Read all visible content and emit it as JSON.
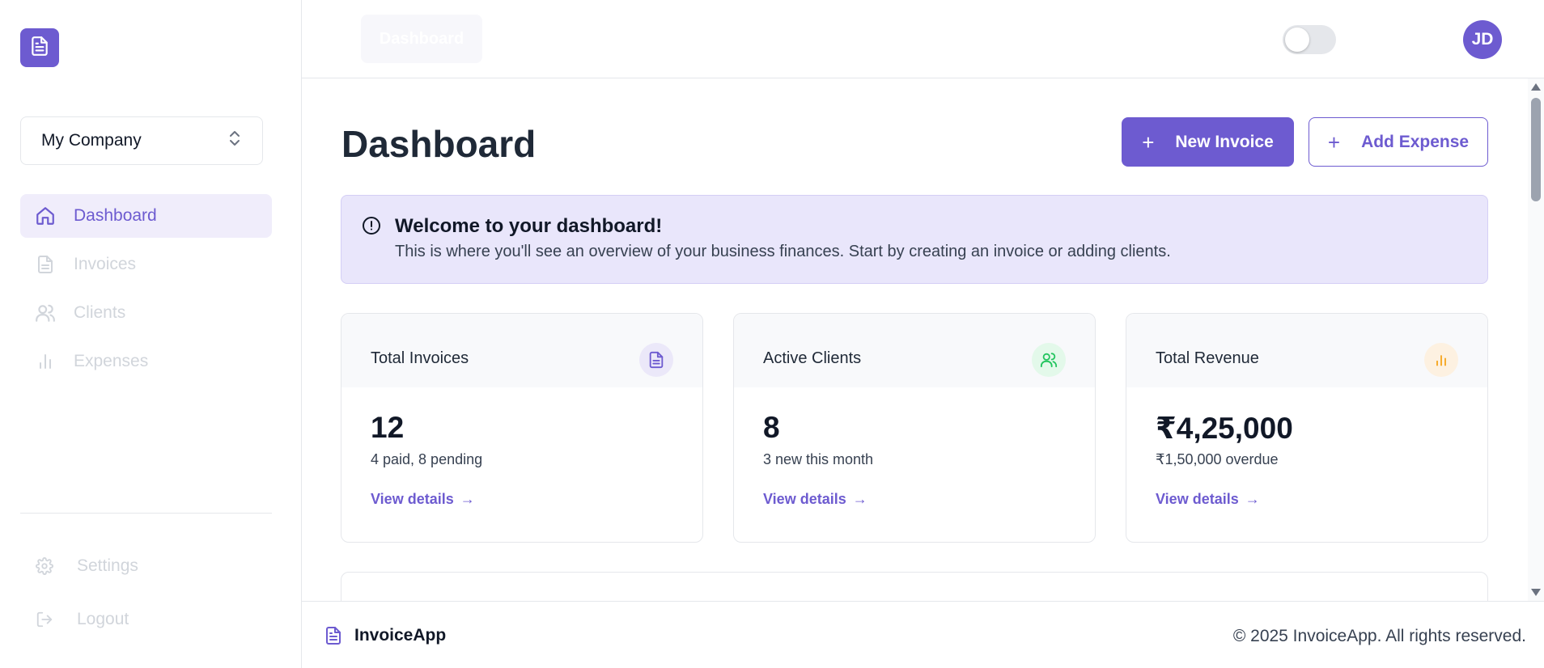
{
  "sidebar": {
    "company": "My Company",
    "nav": [
      {
        "label": "Dashboard",
        "icon": "home-icon",
        "active": true
      },
      {
        "label": "Invoices",
        "icon": "file-icon",
        "active": false
      },
      {
        "label": "Clients",
        "icon": "users-icon",
        "active": false
      },
      {
        "label": "Expenses",
        "icon": "bar-chart-icon",
        "active": false
      }
    ],
    "bottom": [
      {
        "label": "Settings",
        "icon": "gear-icon"
      },
      {
        "label": "Logout",
        "icon": "logout-icon"
      }
    ]
  },
  "header": {
    "tab": "Dashboard",
    "avatar_initials": "JD"
  },
  "main": {
    "title": "Dashboard",
    "new_invoice": "New Invoice",
    "add_expense": "Add Expense",
    "alert": {
      "title": "Welcome to your dashboard!",
      "text": "This is where you'll see an overview of your business finances. Start by creating an invoice or adding clients."
    },
    "cards": [
      {
        "title": "Total Invoices",
        "value": "12",
        "sub": "4 paid, 8 pending",
        "link": "View details",
        "icon": "file-icon",
        "color": "#6d5bd0"
      },
      {
        "title": "Active Clients",
        "value": "8",
        "sub": "3 new this month",
        "link": "View details",
        "icon": "users-icon",
        "color": "#22c55e"
      },
      {
        "title": "Total Revenue",
        "value": "₹4,25,000",
        "sub": "₹1,50,000 overdue",
        "link": "View details",
        "icon": "bar-chart-icon",
        "color": "#f59e0b"
      }
    ]
  },
  "footer": {
    "brand": "InvoiceApp",
    "copyright": "© 2025 InvoiceApp. All rights reserved."
  },
  "colors": {
    "accent": "#6d5bd0",
    "alert_bg": "#e9e6fb",
    "green": "#22c55e",
    "amber": "#f59e0b"
  }
}
